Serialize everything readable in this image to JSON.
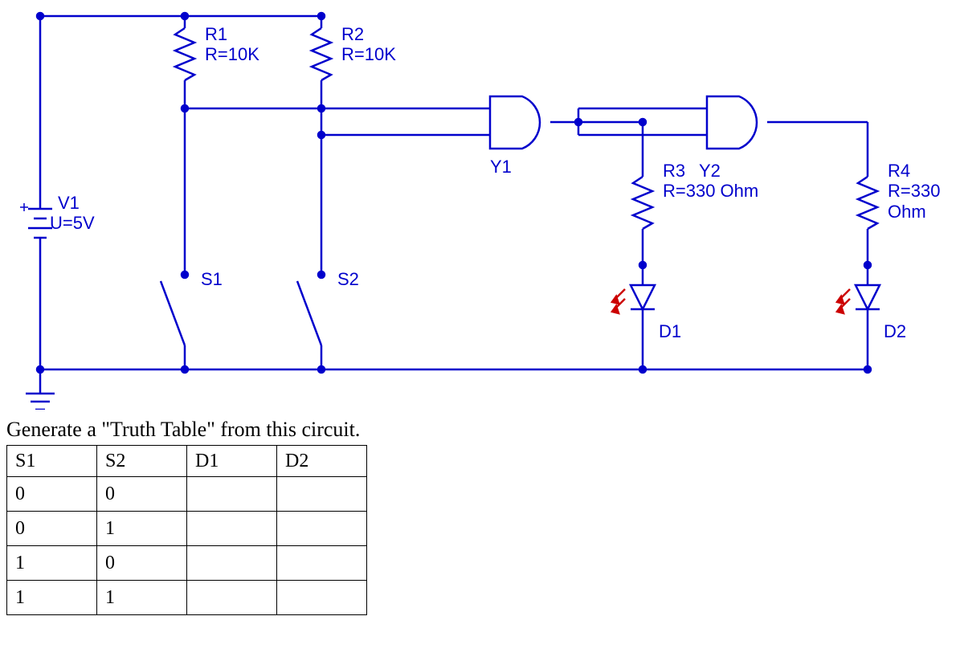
{
  "circuit": {
    "source": {
      "name": "V1",
      "value": "U=5V"
    },
    "resistors": {
      "r1": {
        "name": "R1",
        "value": "R=10K"
      },
      "r2": {
        "name": "R2",
        "value": "R=10K"
      },
      "r3": {
        "name": "R3",
        "value": "R=330 Ohm"
      },
      "r4": {
        "name": "R4",
        "value": "R=330 Ohm"
      }
    },
    "switches": {
      "s1": "S1",
      "s2": "S2"
    },
    "gates": {
      "y1": "Y1",
      "y2": "Y2"
    },
    "leds": {
      "d1": "D1",
      "d2": "D2"
    }
  },
  "question": "Generate a \"Truth Table\" from this circuit.",
  "table": {
    "headers": [
      "S1",
      "S2",
      "D1",
      "D2"
    ],
    "rows": [
      [
        "0",
        "0",
        "",
        ""
      ],
      [
        "0",
        "1",
        "",
        ""
      ],
      [
        "1",
        "0",
        "",
        ""
      ],
      [
        "1",
        "1",
        "",
        ""
      ]
    ]
  }
}
